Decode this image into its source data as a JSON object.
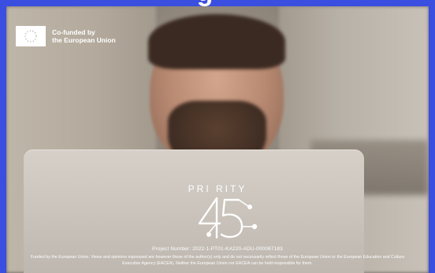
{
  "header": {
    "cropped_text": "g"
  },
  "eu": {
    "line1": "Co-funded by",
    "line2": "the European Union"
  },
  "brand": {
    "name": "PRI    RITY",
    "logo_icon": "priority-45-logo-icon"
  },
  "project": {
    "number": "Project Number: 2022-1-PT01-KA220-ADU-000087183"
  },
  "disclaimer": {
    "text": "Funded by the European Union. Views and opinions expressed are however those of the author(s) only and do not necessarily reflect those of the European Union or the European Education and Culture Executive Agency (EACEA). Neither the European Union nor EACEA can be held responsible for them."
  },
  "colors": {
    "border": "#3a4ee0",
    "text": "#ffffff",
    "logo_stroke": "#ffffff"
  }
}
